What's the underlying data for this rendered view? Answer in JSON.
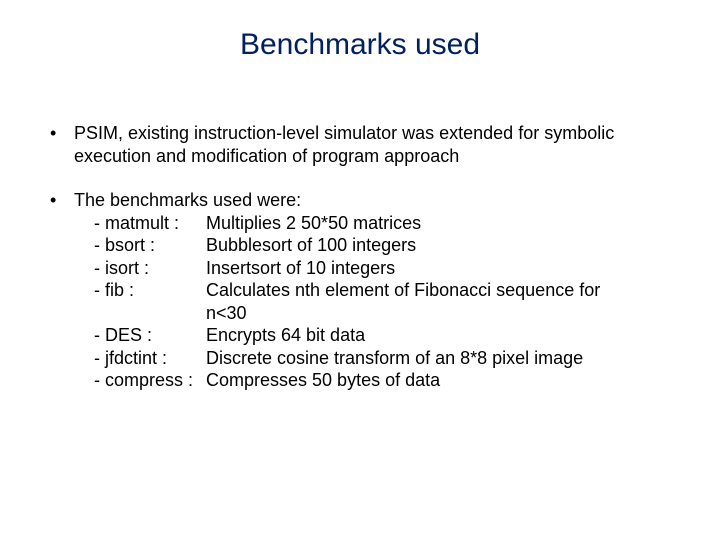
{
  "title": "Benchmarks used",
  "bullet1": "PSIM, existing instruction-level simulator was extended for symbolic execution and modification of program approach",
  "bullet2_intro": "The benchmarks used were:",
  "benchmarks": [
    {
      "name": "- matmult :",
      "desc": "Multiplies 2 50*50 matrices"
    },
    {
      "name": "- bsort :",
      "desc": "Bubblesort of 100 integers"
    },
    {
      "name": "- isort :",
      "desc": "Insertsort of 10 integers"
    },
    {
      "name": "- fib :",
      "desc": "Calculates nth element of Fibonacci sequence for"
    }
  ],
  "fib_cont": "n<30",
  "benchmarks2": [
    {
      "name": "- DES :",
      "desc": "Encrypts 64 bit data"
    },
    {
      "name": "- jfdctint :",
      "desc": "Discrete cosine transform of an 8*8 pixel image"
    },
    {
      "name": "- compress :",
      "desc": "Compresses 50 bytes of data"
    }
  ]
}
